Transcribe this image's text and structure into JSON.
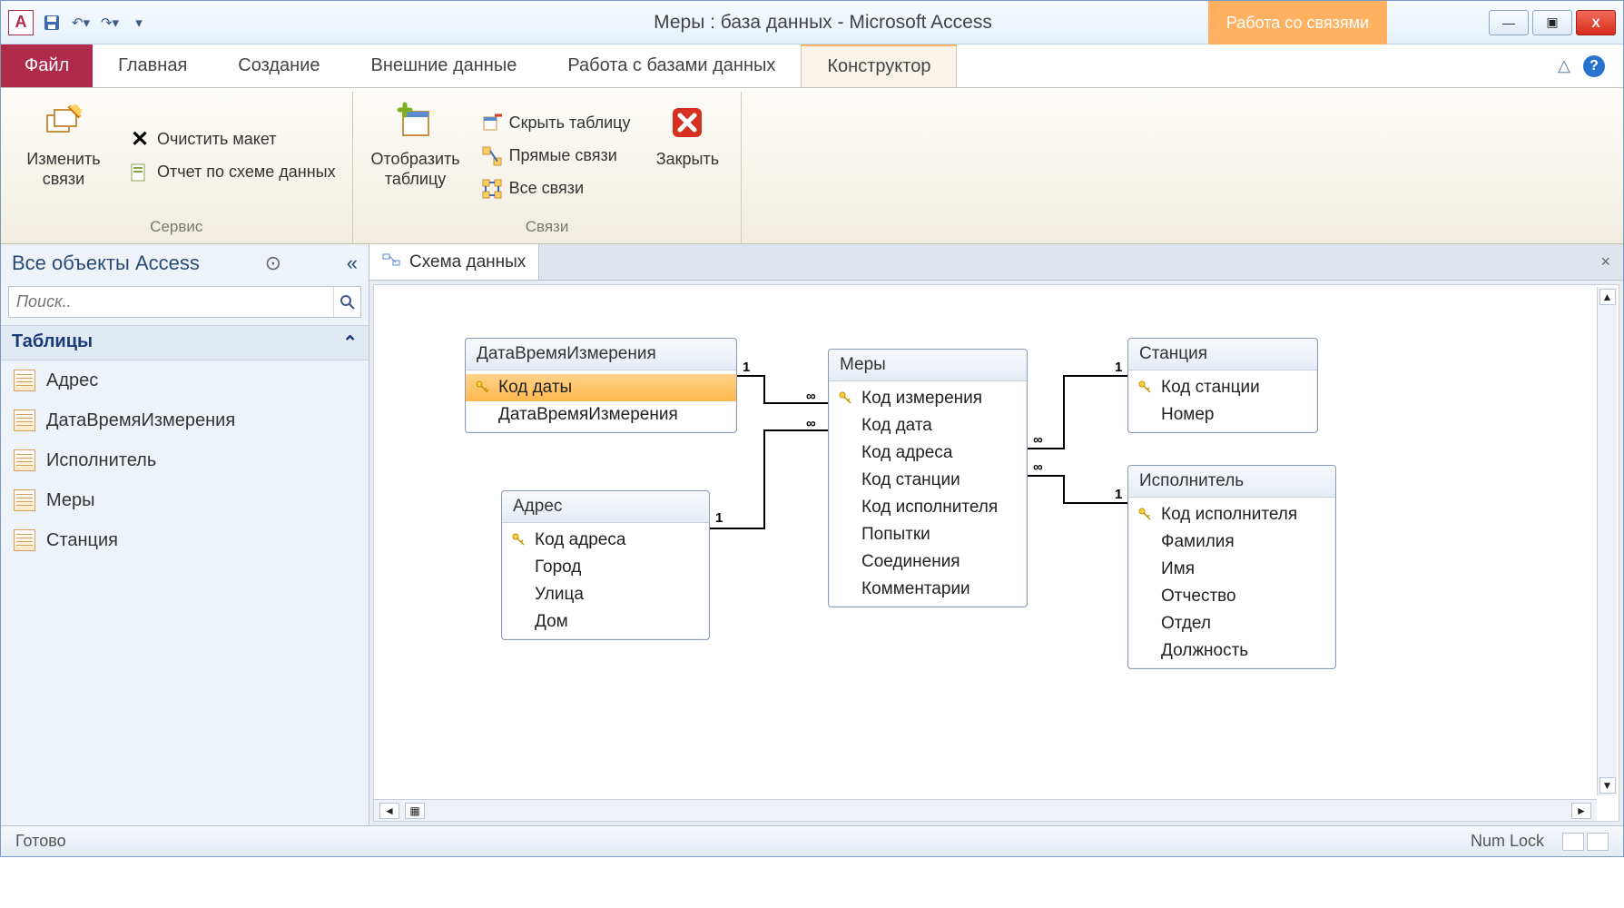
{
  "titlebar": {
    "title": "Меры : база данных  -  Microsoft Access",
    "context_tab": "Работа со связями"
  },
  "win_controls": {
    "min": "—",
    "max": "▣",
    "close": "X"
  },
  "tabs": {
    "file": "Файл",
    "items": [
      "Главная",
      "Создание",
      "Внешние данные",
      "Работа с базами данных",
      "Конструктор"
    ],
    "active_index": 4,
    "collapse": "△",
    "help": "?"
  },
  "ribbon": {
    "group1": {
      "label": "Сервис",
      "edit_rel": "Изменить связи",
      "clear_layout": "Очистить макет",
      "rel_report": "Отчет по схеме данных"
    },
    "group2": {
      "label": "Связи",
      "show_table": "Отобразить таблицу",
      "hide_table": "Скрыть таблицу",
      "direct_rel": "Прямые связи",
      "all_rel": "Все связи",
      "close": "Закрыть"
    }
  },
  "nav": {
    "header": "Все объекты Access",
    "collapse": "«",
    "search_placeholder": "Поиск..",
    "group": "Таблицы",
    "items": [
      "Адрес",
      "ДатаВремяИзмерения",
      "Исполнитель",
      "Меры",
      "Станция"
    ]
  },
  "doc": {
    "tab_title": "Схема данных",
    "close": "×"
  },
  "tables": {
    "t1": {
      "title": "ДатаВремяИзмерения",
      "fields": [
        "Код даты",
        "ДатаВремяИзмерения"
      ],
      "key_index": 0,
      "selected_index": 0
    },
    "t2": {
      "title": "Адрес",
      "fields": [
        "Код адреса",
        "Город",
        "Улица",
        "Дом"
      ],
      "key_index": 0
    },
    "t3": {
      "title": "Меры",
      "fields": [
        "Код измерения",
        "Код дата",
        "Код адреса",
        "Код станции",
        "Код исполнителя",
        "Попытки",
        "Соединения",
        "Комментарии"
      ],
      "key_index": 0
    },
    "t4": {
      "title": "Станция",
      "fields": [
        "Код станции",
        "Номер"
      ],
      "key_index": 0
    },
    "t5": {
      "title": "Исполнитель",
      "fields": [
        "Код исполнителя",
        "Фамилия",
        "Имя",
        "Отчество",
        "Отдел",
        "Должность"
      ],
      "key_index": 0
    }
  },
  "rel_labels": {
    "one": "1",
    "many": "∞"
  },
  "status": {
    "ready": "Готово",
    "numlock": "Num Lock"
  }
}
